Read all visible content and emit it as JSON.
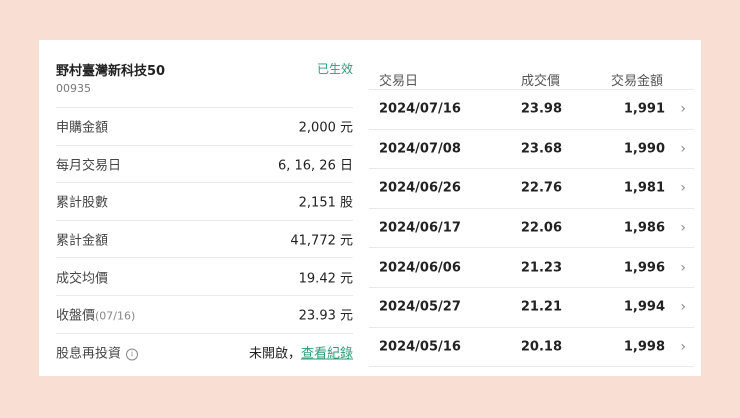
{
  "fund": {
    "name": "野村臺灣新科技50",
    "code": "00935",
    "status": "已生效"
  },
  "info": [
    {
      "label": "申購金額",
      "value": "2,000 元"
    },
    {
      "label": "每月交易日",
      "value": "6, 16, 26 日"
    },
    {
      "label": "累計股數",
      "value": "2,151 股"
    },
    {
      "label": "累計金額",
      "value": "41,772 元"
    },
    {
      "label": "成交均價",
      "value": "19.42 元"
    },
    {
      "label": "收盤價",
      "label_sub": "(07/16)",
      "value": "23.93 元"
    },
    {
      "label": "股息再投資",
      "info_icon": "i",
      "value": "未開啟，",
      "link": "查看紀錄"
    }
  ],
  "table": {
    "headers": {
      "date": "交易日",
      "price": "成交價",
      "amount": "交易金額"
    },
    "rows": [
      {
        "date": "2024/07/16",
        "price": "23.98",
        "amount": "1,991"
      },
      {
        "date": "2024/07/08",
        "price": "23.68",
        "amount": "1,990"
      },
      {
        "date": "2024/06/26",
        "price": "22.76",
        "amount": "1,981"
      },
      {
        "date": "2024/06/17",
        "price": "22.06",
        "amount": "1,986"
      },
      {
        "date": "2024/06/06",
        "price": "21.23",
        "amount": "1,996"
      },
      {
        "date": "2024/05/27",
        "price": "21.21",
        "amount": "1,994"
      },
      {
        "date": "2024/05/16",
        "price": "20.18",
        "amount": "1,998"
      }
    ],
    "chevron": "›"
  },
  "colors": {
    "background": "#f9dfd3",
    "accent": "#2e9b76"
  }
}
